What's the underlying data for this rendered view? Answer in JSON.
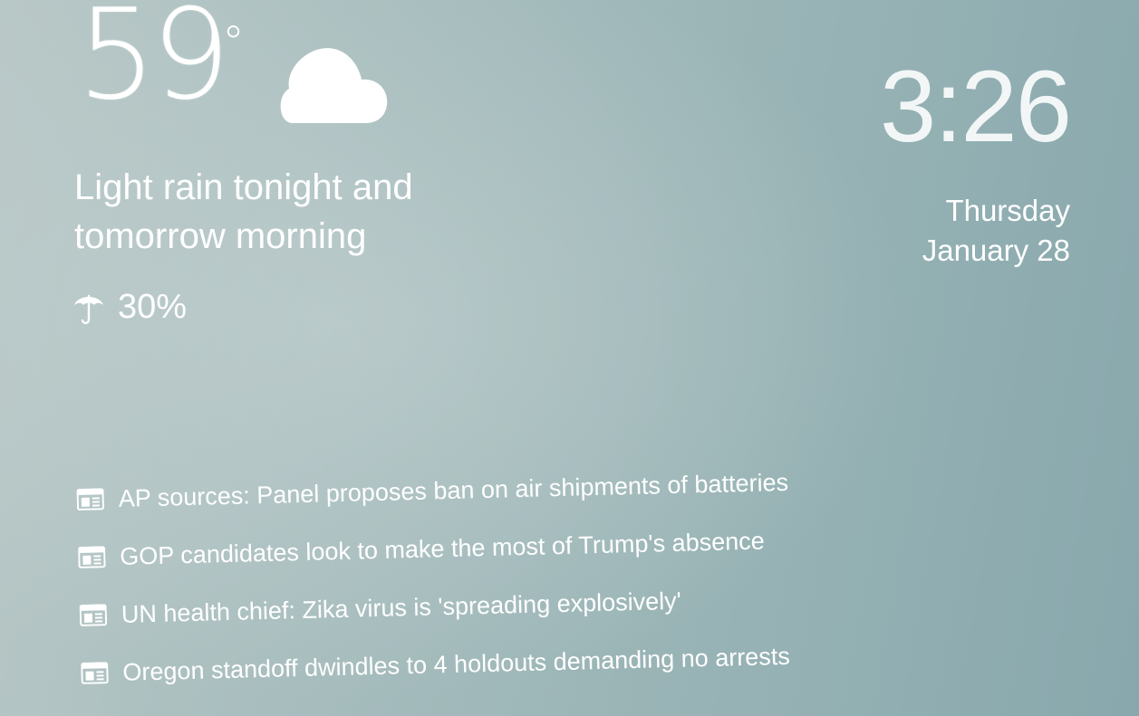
{
  "weather": {
    "temperature": "59",
    "unit_symbol": "°",
    "condition_icon": "cloud-icon",
    "summary_line1": "Light rain tonight and",
    "summary_line2": "tomorrow morning",
    "precip_icon": "umbrella-icon",
    "precip_chance": "30%"
  },
  "clock": {
    "time": "3:26",
    "day": "Thursday",
    "date": "January 28"
  },
  "news": {
    "icon": "newspaper-icon",
    "items": [
      {
        "headline": "AP sources: Panel proposes ban on air shipments of batteries"
      },
      {
        "headline": "GOP candidates look to make the most of Trump's absence"
      },
      {
        "headline": "UN health chief: Zika virus is 'spreading explosively'"
      },
      {
        "headline": "Oregon standoff dwindles to 4 holdouts demanding no arrests"
      }
    ]
  },
  "colors": {
    "background_left": "#b9c8c7",
    "background_right": "#88a8ad",
    "text": "#ffffff"
  }
}
